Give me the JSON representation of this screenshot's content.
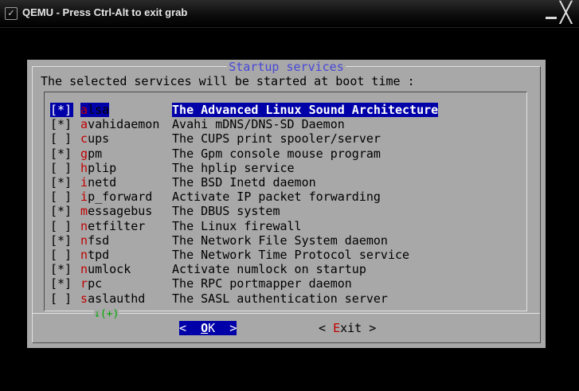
{
  "window": {
    "menu_glyph": "✓",
    "title": "QEMU - Press Ctrl-Alt to exit grab",
    "close_glyph": "╳"
  },
  "dialog": {
    "title": "Startup services",
    "prompt": "The selected services will be started at boot time :",
    "more_indicator": "↓(+)",
    "services": [
      {
        "checked": "[*]",
        "first": "a",
        "rest": "lsa",
        "desc": "The Advanced Linux Sound Architecture",
        "selected": true
      },
      {
        "checked": "[*]",
        "first": "a",
        "rest": "vahidaemon",
        "desc": "Avahi mDNS/DNS-SD Daemon"
      },
      {
        "checked": "[ ]",
        "first": "c",
        "rest": "ups",
        "desc": "The CUPS print spooler/server"
      },
      {
        "checked": "[*]",
        "first": "g",
        "rest": "pm",
        "desc": "The Gpm console mouse program"
      },
      {
        "checked": "[ ]",
        "first": "h",
        "rest": "plip",
        "desc": "The hplip service"
      },
      {
        "checked": "[*]",
        "first": "i",
        "rest": "netd",
        "desc": "The BSD Inetd daemon"
      },
      {
        "checked": "[ ]",
        "first": "i",
        "rest": "p_forward",
        "desc": "Activate IP packet forwarding"
      },
      {
        "checked": "[*]",
        "first": "m",
        "rest": "essagebus",
        "desc": "The DBUS system"
      },
      {
        "checked": "[ ]",
        "first": "n",
        "rest": "etfilter",
        "desc": "The Linux firewall"
      },
      {
        "checked": "[*]",
        "first": "n",
        "rest": "fsd",
        "desc": "The Network File System daemon"
      },
      {
        "checked": "[ ]",
        "first": "n",
        "rest": "tpd",
        "desc": "The Network Time Protocol service"
      },
      {
        "checked": "[*]",
        "first": "n",
        "rest": "umlock",
        "desc": "Activate numlock on startup"
      },
      {
        "checked": "[*]",
        "first": "r",
        "rest": "pc",
        "desc": "The RPC portmapper daemon"
      },
      {
        "checked": "[ ]",
        "first": "s",
        "rest": "aslauthd",
        "desc": "The SASL authentication server"
      }
    ],
    "buttons": {
      "ok": {
        "left": "<  ",
        "hot": "O",
        "rest": "K",
        "right": "  >"
      },
      "exit": {
        "left": "< ",
        "hot": "E",
        "rest": "xit",
        "right": " >"
      }
    }
  },
  "colors": {
    "dialog_bg": "#a8a8a8",
    "selection": "#0000a8",
    "hotkey": "#c00000",
    "title": "#4848d8",
    "more": "#00a800"
  }
}
